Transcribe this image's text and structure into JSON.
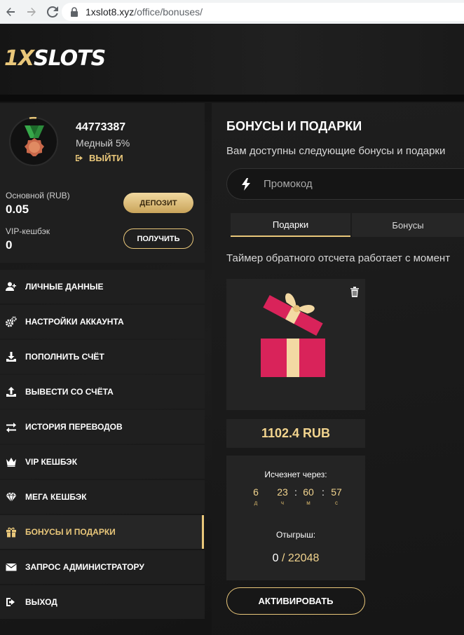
{
  "browser": {
    "url_host": "1xslot8.xyz",
    "url_path": "/office/bonuses/"
  },
  "header": {
    "logo_prefix": "1X",
    "logo_suffix": "SLOTS"
  },
  "profile": {
    "user_id": "44773387",
    "level": "Медный 5%",
    "logout_label": "ВЫЙТИ",
    "main_balance_label": "Основной (RUB)",
    "main_balance_value": "0.05",
    "vip_label": "VIP-кешбэк",
    "vip_value": "0",
    "deposit_label": "ДЕПОЗИТ",
    "receive_label": "ПОЛУЧИТЬ"
  },
  "sidebar": {
    "items": [
      {
        "label": "ЛИЧНЫЕ ДАННЫЕ",
        "icon": "user-plus-icon"
      },
      {
        "label": "НАСТРОЙКИ АККАУНТА",
        "icon": "gears-icon"
      },
      {
        "label": "ПОПОЛНИТЬ СЧЁТ",
        "icon": "download-icon"
      },
      {
        "label": "ВЫВЕСТИ СО СЧЁТА",
        "icon": "upload-icon"
      },
      {
        "label": "ИСТОРИЯ ПЕРЕВОДОВ",
        "icon": "transfer-icon"
      },
      {
        "label": "VIP КЕШБЭК",
        "icon": "crown-icon"
      },
      {
        "label": "МЕГА КЕШБЭК",
        "icon": "diamond-icon"
      },
      {
        "label": "БОНУСЫ И ПОДАРКИ",
        "icon": "gift-icon",
        "active": true
      },
      {
        "label": "ЗАПРОС АДМИНИСТРАТОРУ",
        "icon": "envelope-icon"
      },
      {
        "label": "ВЫХОД",
        "icon": "sign-out-icon"
      }
    ]
  },
  "main": {
    "title": "БОНУСЫ И ПОДАРКИ",
    "subtitle": "Вам доступны следующие бонусы и подарки",
    "promo_placeholder": "Промокод",
    "tabs": [
      {
        "label": "Подарки",
        "active": true
      },
      {
        "label": "Бонусы",
        "active": false
      }
    ],
    "timer_text": "Таймер обратного отсчета работает с момент"
  },
  "gift": {
    "amount": "1102.4 RUB",
    "expires_label": "Исчезнет через:",
    "countdown": {
      "days": "6",
      "days_label": "д",
      "hours": "23",
      "hours_label": "ч",
      "minutes": "60",
      "minutes_label": "м",
      "seconds": "57",
      "seconds_label": "с"
    },
    "wager_label": "Отыгрыш:",
    "wager_current": "0",
    "wager_separator": "/",
    "wager_total": "22048",
    "activate_label": "АКТИВИРОВАТЬ"
  },
  "colors": {
    "accent_gold": "#e9c77a",
    "gift_red": "#d9235a",
    "gift_ribbon": "#f3d9a3"
  }
}
